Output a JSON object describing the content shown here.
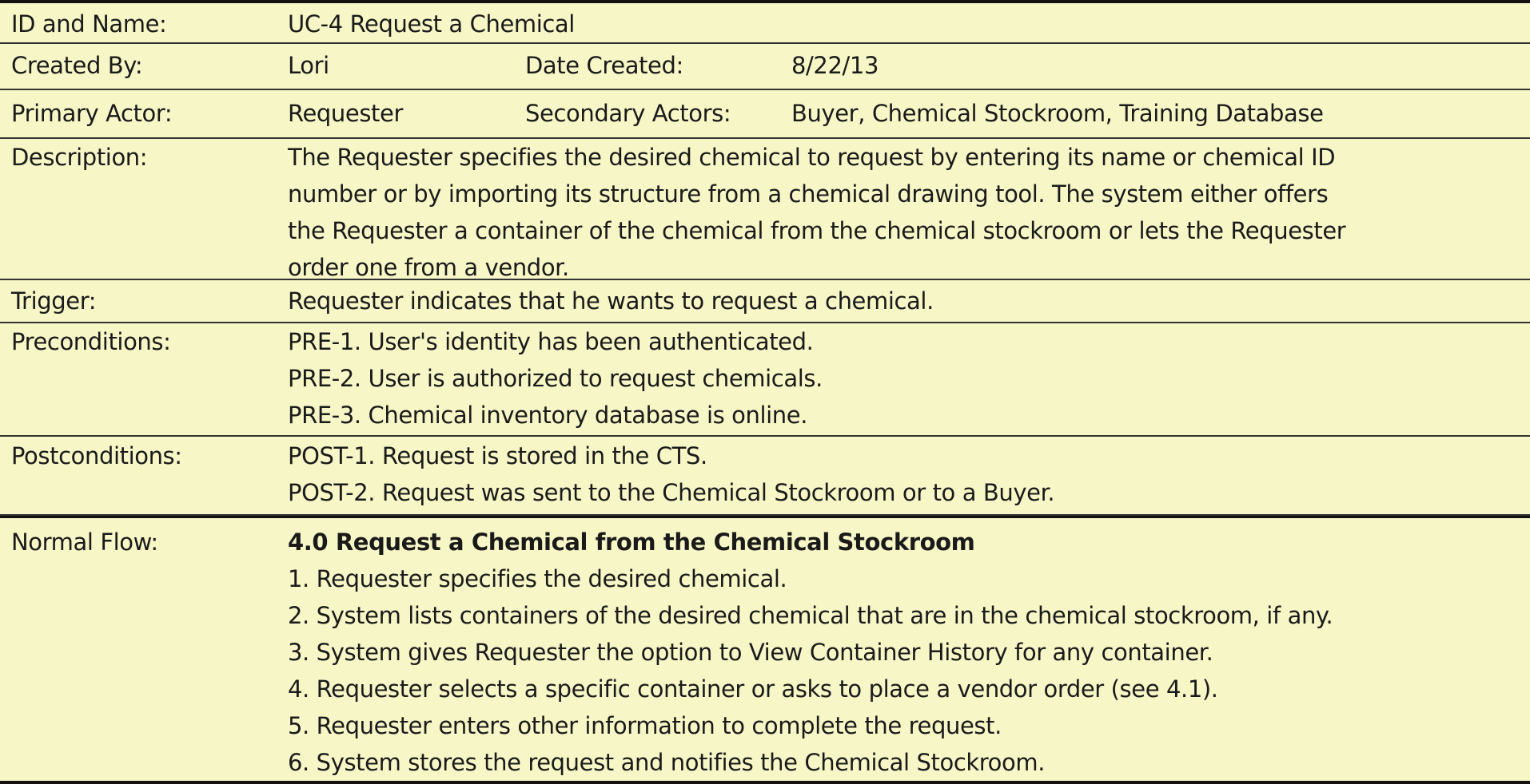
{
  "usecase": {
    "id_label": "ID and Name:",
    "id_value": "UC-4 Request a Chemical",
    "created_by_label": "Created By:",
    "created_by_value": "Lori",
    "date_created_label": "Date Created:",
    "date_created_value": "8/22/13",
    "primary_actor_label": "Primary Actor:",
    "primary_actor_value": "Requester",
    "secondary_actors_label": "Secondary Actors:",
    "secondary_actors_value": "Buyer, Chemical Stockroom, Training Database",
    "description_label": "Description:",
    "description_lines": [
      "The Requester specifies the desired chemical to request by entering its name or chemical ID",
      "number or by importing its structure from a chemical drawing tool. The system either offers",
      "the Requester a container of the chemical from the chemical stockroom or lets the Requester",
      "order one from a vendor."
    ],
    "trigger_label": "Trigger:",
    "trigger_value": "Requester indicates that he wants to request a chemical.",
    "preconditions_label": "Preconditions:",
    "preconditions": [
      "PRE-1. User's identity has been authenticated.",
      "PRE-2. User is authorized to request chemicals.",
      "PRE-3. Chemical inventory database is online."
    ],
    "postconditions_label": "Postconditions:",
    "postconditions": [
      "POST-1. Request is stored in the CTS.",
      "POST-2. Request was sent to the Chemical Stockroom or to a Buyer."
    ],
    "normal_flow_label": "Normal Flow:",
    "normal_flow_heading": "4.0 Request a Chemical from the Chemical Stockroom",
    "normal_flow_steps": [
      "1. Requester specifies the desired chemical.",
      "2. System lists containers of the desired chemical that are in the chemical stockroom, if any.",
      "3. System gives Requester the option to View Container History for any container.",
      "4. Requester selects a specific container or asks to place a vendor order (see 4.1).",
      "5. Requester enters other information to complete the request.",
      "6. System stores the request and notifies the Chemical Stockroom."
    ]
  }
}
